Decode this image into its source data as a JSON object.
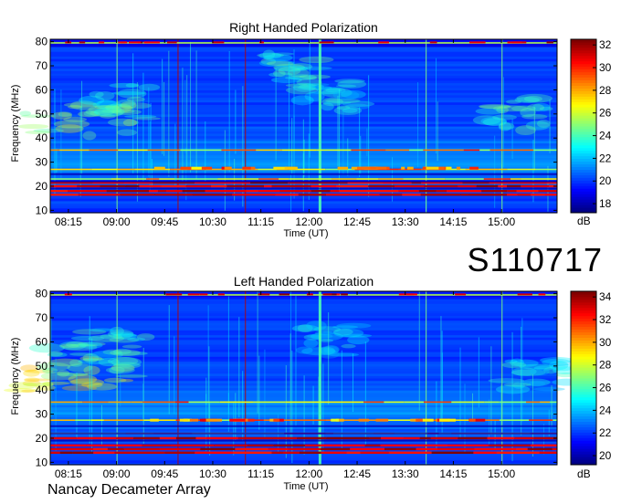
{
  "observation_id": "S110717",
  "footer_text": "Nancay Decameter Array",
  "chart_data": [
    {
      "type": "heatmap",
      "title": "Right Handed Polarization",
      "xlabel": "Time (UT)",
      "ylabel": "Frequency (MHz)",
      "x_ticks": [
        "08:15",
        "09:00",
        "09:45",
        "10:30",
        "11:15",
        "12:00",
        "12:45",
        "13:30",
        "14:15",
        "15:00"
      ],
      "y_ticks": [
        10,
        20,
        30,
        40,
        50,
        60,
        70,
        80
      ],
      "ylim": [
        9,
        81
      ],
      "colorbar": {
        "label": "dB",
        "ticks": [
          18,
          20,
          22,
          24,
          26,
          28,
          30,
          32
        ],
        "range": [
          17.2,
          32.5
        ]
      },
      "features": {
        "strong_bands_mhz": [
          16.5,
          18,
          20,
          21.5,
          23,
          27,
          35
        ],
        "vertical_event_times": [
          "09:00",
          "09:57",
          "11:00",
          "12:09",
          "13:49",
          "15:00"
        ]
      }
    },
    {
      "type": "heatmap",
      "title": "Left Handed Polarization",
      "xlabel": "Time (UT)",
      "ylabel": "Frequency (MHz)",
      "x_ticks": [
        "08:15",
        "09:00",
        "09:45",
        "10:30",
        "11:15",
        "12:00",
        "12:45",
        "13:30",
        "14:15",
        "15:00"
      ],
      "y_ticks": [
        10,
        20,
        30,
        40,
        50,
        60,
        70,
        80
      ],
      "ylim": [
        9,
        81
      ],
      "colorbar": {
        "label": "dB",
        "ticks": [
          20,
          22,
          24,
          26,
          28,
          30,
          32,
          34
        ],
        "range": [
          19.2,
          34.5
        ]
      },
      "features": {
        "strong_bands_mhz": [
          14,
          15.5,
          17,
          20,
          22,
          27.5,
          35
        ],
        "vertical_event_times": [
          "09:00",
          "09:57",
          "11:00",
          "12:09",
          "13:49",
          "15:00"
        ]
      }
    }
  ]
}
